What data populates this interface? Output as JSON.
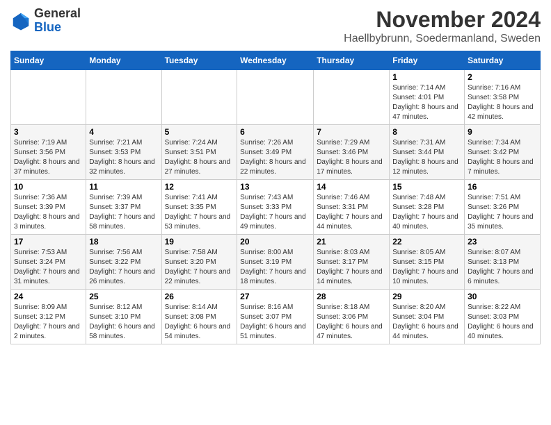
{
  "header": {
    "logo": {
      "general": "General",
      "blue": "Blue"
    },
    "month": "November 2024",
    "location": "Haellbybrunn, Soedermanland, Sweden"
  },
  "weekdays": [
    "Sunday",
    "Monday",
    "Tuesday",
    "Wednesday",
    "Thursday",
    "Friday",
    "Saturday"
  ],
  "weeks": [
    [
      {
        "day": "",
        "info": ""
      },
      {
        "day": "",
        "info": ""
      },
      {
        "day": "",
        "info": ""
      },
      {
        "day": "",
        "info": ""
      },
      {
        "day": "",
        "info": ""
      },
      {
        "day": "1",
        "info": "Sunrise: 7:14 AM\nSunset: 4:01 PM\nDaylight: 8 hours and 47 minutes."
      },
      {
        "day": "2",
        "info": "Sunrise: 7:16 AM\nSunset: 3:58 PM\nDaylight: 8 hours and 42 minutes."
      }
    ],
    [
      {
        "day": "3",
        "info": "Sunrise: 7:19 AM\nSunset: 3:56 PM\nDaylight: 8 hours and 37 minutes."
      },
      {
        "day": "4",
        "info": "Sunrise: 7:21 AM\nSunset: 3:53 PM\nDaylight: 8 hours and 32 minutes."
      },
      {
        "day": "5",
        "info": "Sunrise: 7:24 AM\nSunset: 3:51 PM\nDaylight: 8 hours and 27 minutes."
      },
      {
        "day": "6",
        "info": "Sunrise: 7:26 AM\nSunset: 3:49 PM\nDaylight: 8 hours and 22 minutes."
      },
      {
        "day": "7",
        "info": "Sunrise: 7:29 AM\nSunset: 3:46 PM\nDaylight: 8 hours and 17 minutes."
      },
      {
        "day": "8",
        "info": "Sunrise: 7:31 AM\nSunset: 3:44 PM\nDaylight: 8 hours and 12 minutes."
      },
      {
        "day": "9",
        "info": "Sunrise: 7:34 AM\nSunset: 3:42 PM\nDaylight: 8 hours and 7 minutes."
      }
    ],
    [
      {
        "day": "10",
        "info": "Sunrise: 7:36 AM\nSunset: 3:39 PM\nDaylight: 8 hours and 3 minutes."
      },
      {
        "day": "11",
        "info": "Sunrise: 7:39 AM\nSunset: 3:37 PM\nDaylight: 7 hours and 58 minutes."
      },
      {
        "day": "12",
        "info": "Sunrise: 7:41 AM\nSunset: 3:35 PM\nDaylight: 7 hours and 53 minutes."
      },
      {
        "day": "13",
        "info": "Sunrise: 7:43 AM\nSunset: 3:33 PM\nDaylight: 7 hours and 49 minutes."
      },
      {
        "day": "14",
        "info": "Sunrise: 7:46 AM\nSunset: 3:31 PM\nDaylight: 7 hours and 44 minutes."
      },
      {
        "day": "15",
        "info": "Sunrise: 7:48 AM\nSunset: 3:28 PM\nDaylight: 7 hours and 40 minutes."
      },
      {
        "day": "16",
        "info": "Sunrise: 7:51 AM\nSunset: 3:26 PM\nDaylight: 7 hours and 35 minutes."
      }
    ],
    [
      {
        "day": "17",
        "info": "Sunrise: 7:53 AM\nSunset: 3:24 PM\nDaylight: 7 hours and 31 minutes."
      },
      {
        "day": "18",
        "info": "Sunrise: 7:56 AM\nSunset: 3:22 PM\nDaylight: 7 hours and 26 minutes."
      },
      {
        "day": "19",
        "info": "Sunrise: 7:58 AM\nSunset: 3:20 PM\nDaylight: 7 hours and 22 minutes."
      },
      {
        "day": "20",
        "info": "Sunrise: 8:00 AM\nSunset: 3:19 PM\nDaylight: 7 hours and 18 minutes."
      },
      {
        "day": "21",
        "info": "Sunrise: 8:03 AM\nSunset: 3:17 PM\nDaylight: 7 hours and 14 minutes."
      },
      {
        "day": "22",
        "info": "Sunrise: 8:05 AM\nSunset: 3:15 PM\nDaylight: 7 hours and 10 minutes."
      },
      {
        "day": "23",
        "info": "Sunrise: 8:07 AM\nSunset: 3:13 PM\nDaylight: 7 hours and 6 minutes."
      }
    ],
    [
      {
        "day": "24",
        "info": "Sunrise: 8:09 AM\nSunset: 3:12 PM\nDaylight: 7 hours and 2 minutes."
      },
      {
        "day": "25",
        "info": "Sunrise: 8:12 AM\nSunset: 3:10 PM\nDaylight: 6 hours and 58 minutes."
      },
      {
        "day": "26",
        "info": "Sunrise: 8:14 AM\nSunset: 3:08 PM\nDaylight: 6 hours and 54 minutes."
      },
      {
        "day": "27",
        "info": "Sunrise: 8:16 AM\nSunset: 3:07 PM\nDaylight: 6 hours and 51 minutes."
      },
      {
        "day": "28",
        "info": "Sunrise: 8:18 AM\nSunset: 3:06 PM\nDaylight: 6 hours and 47 minutes."
      },
      {
        "day": "29",
        "info": "Sunrise: 8:20 AM\nSunset: 3:04 PM\nDaylight: 6 hours and 44 minutes."
      },
      {
        "day": "30",
        "info": "Sunrise: 8:22 AM\nSunset: 3:03 PM\nDaylight: 6 hours and 40 minutes."
      }
    ]
  ]
}
